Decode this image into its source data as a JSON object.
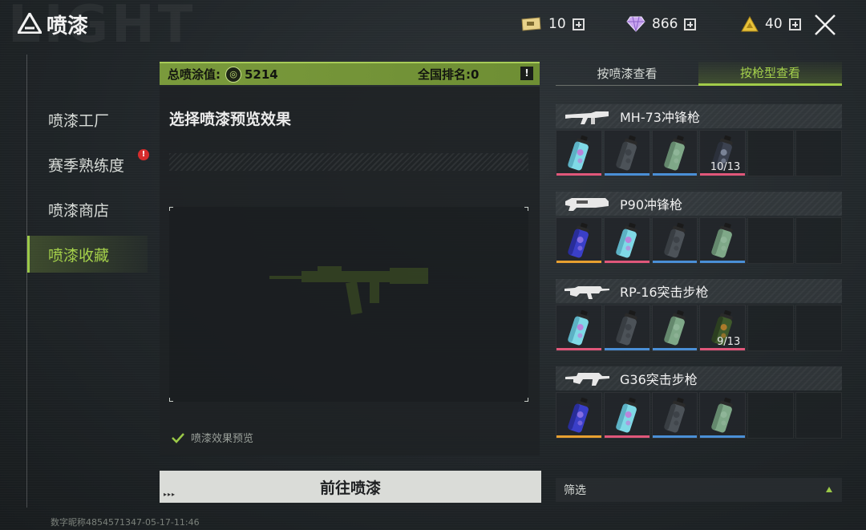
{
  "header": {
    "title": "喷漆",
    "currencies": [
      {
        "icon": "ticket-icon",
        "value": "10"
      },
      {
        "icon": "diamond-icon",
        "value": "866"
      },
      {
        "icon": "gold-triangle-icon",
        "value": "40"
      }
    ]
  },
  "sidebar": {
    "items": [
      {
        "label": "喷漆工厂",
        "active": false
      },
      {
        "label": "赛季熟练度",
        "active": false,
        "alert": "!"
      },
      {
        "label": "喷漆商店",
        "active": false
      },
      {
        "label": "喷漆收藏",
        "active": true
      }
    ]
  },
  "score": {
    "total_label": "总喷涂值:",
    "total_value": "5214",
    "rank_label": "全国排名:0",
    "info": "!"
  },
  "preview": {
    "title": "选择喷漆预览效果",
    "checkbox_label": "喷漆效果预览",
    "checked": true
  },
  "go_button": {
    "label": "前往喷漆",
    "dots": "▸▸▸"
  },
  "footer": {
    "id_text": "数字昵称4854571347-05-17-11:46"
  },
  "tabs": [
    {
      "label": "按喷漆查看",
      "active": false
    },
    {
      "label": "按枪型查看",
      "active": true
    }
  ],
  "weapons": [
    {
      "name": "MH-73冲锋枪",
      "slots": [
        {
          "can": "cyan-pattern",
          "rarity": "#e0577a"
        },
        {
          "can": "dark",
          "rarity": "#4a8fd6"
        },
        {
          "can": "green",
          "rarity": "#4a8fd6"
        },
        {
          "can": "camo-dark",
          "rarity": "#e0577a",
          "count": "10/13"
        },
        {
          "can": null
        },
        {
          "can": null
        }
      ]
    },
    {
      "name": "P90冲锋枪",
      "slots": [
        {
          "can": "blue-purple",
          "rarity": "#e8a030"
        },
        {
          "can": "cyan-pattern",
          "rarity": "#e0577a"
        },
        {
          "can": "dark",
          "rarity": "#4a8fd6"
        },
        {
          "can": "green",
          "rarity": "#4a8fd6"
        },
        {
          "can": null
        },
        {
          "can": null
        }
      ]
    },
    {
      "name": "RP-16突击步枪",
      "slots": [
        {
          "can": "cyan-pattern",
          "rarity": "#e0577a"
        },
        {
          "can": "dark",
          "rarity": "#4a8fd6"
        },
        {
          "can": "green",
          "rarity": "#4a8fd6"
        },
        {
          "can": "camo-orange",
          "rarity": "#e0577a",
          "count": "9/13"
        },
        {
          "can": null
        },
        {
          "can": null
        }
      ]
    },
    {
      "name": "G36突击步枪",
      "slots": [
        {
          "can": "blue-purple",
          "rarity": "#e8a030"
        },
        {
          "can": "cyan-pattern",
          "rarity": "#e0577a"
        },
        {
          "can": "dark",
          "rarity": "#4a8fd6"
        },
        {
          "can": "green",
          "rarity": "#4a8fd6"
        },
        {
          "can": null
        },
        {
          "can": null
        }
      ]
    }
  ],
  "filter": {
    "label": "筛选"
  },
  "colors": {
    "accent": "#9bc948",
    "score_bar": "#7a9a3c"
  }
}
